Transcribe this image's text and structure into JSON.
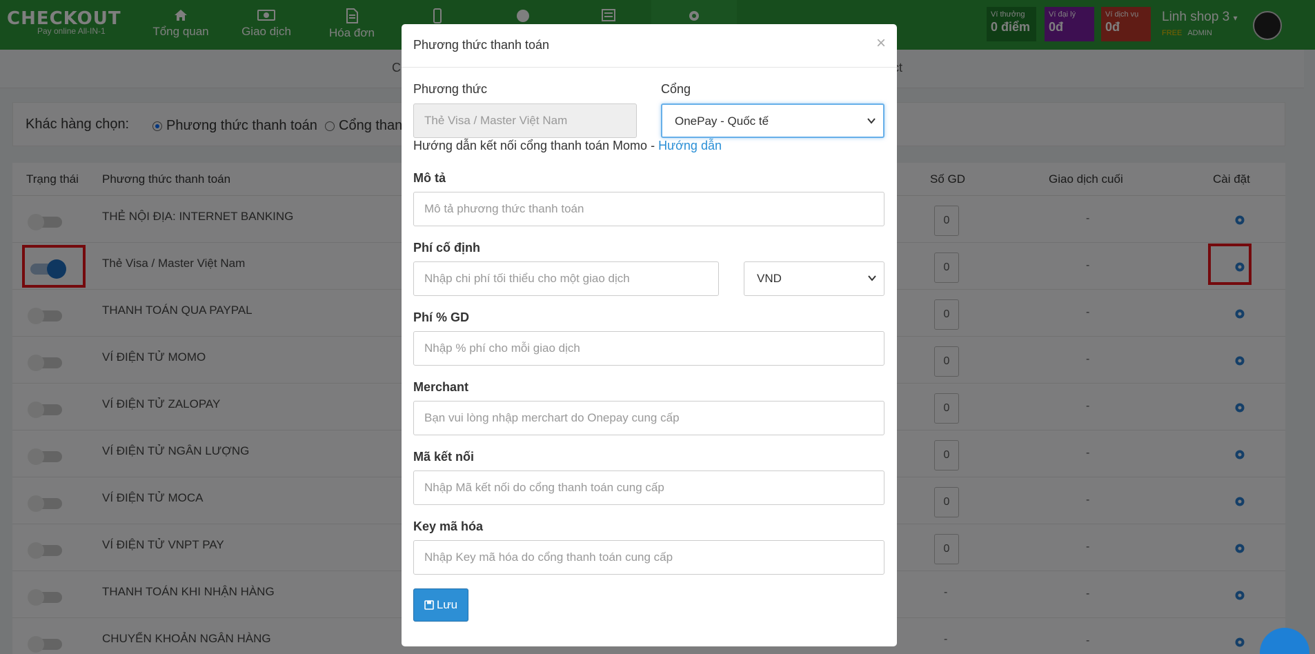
{
  "header": {
    "logo_main": "CHECKOUT",
    "logo_sub": "Pay online All-IN-1",
    "nav": [
      {
        "label": "Tổng quan",
        "icon": "home-icon"
      },
      {
        "label": "Giao dịch",
        "icon": "money-icon"
      },
      {
        "label": "Hóa đơn",
        "icon": "document-icon"
      },
      {
        "label": "",
        "icon": "mobile-icon"
      },
      {
        "label": "",
        "icon": "globe-icon"
      },
      {
        "label": "",
        "icon": "newspaper-icon"
      },
      {
        "label": "",
        "icon": "gear-icon"
      }
    ],
    "wallets": [
      {
        "label": "Ví thưởng",
        "value": "0 điểm",
        "color": "#1f7a2a"
      },
      {
        "label": "Ví đại lý",
        "value": "0đ",
        "color": "#7b1fa2"
      },
      {
        "label": "Ví dịch vụ",
        "value": "0đ",
        "color": "#c0392b"
      }
    ],
    "shop_name": "Linh shop 3",
    "plan": "FREE",
    "role": "ADMIN"
  },
  "subnav": {
    "left": "C",
    "right": "ct"
  },
  "filter": {
    "label": "Khác hàng chọn:",
    "option1": "Phương thức thanh toán",
    "option2": "Cổng than"
  },
  "table": {
    "headers": {
      "status": "Trạng thái",
      "method": "Phương thức thanh toán",
      "count": "Số GD",
      "last": "Giao dịch cuối",
      "settings": "Cài đặt"
    },
    "rows": [
      {
        "name": "THẺ NỘI ĐỊA: INTERNET BANKING",
        "on": false,
        "count": "0",
        "last": "-"
      },
      {
        "name": "Thẻ Visa / Master Việt Nam",
        "on": true,
        "count": "0",
        "last": "-"
      },
      {
        "name": "THANH TOÁN QUA PAYPAL",
        "on": false,
        "count": "0",
        "last": "-"
      },
      {
        "name": "VÍ ĐIỆN TỬ MOMO",
        "on": false,
        "count": "0",
        "last": "-"
      },
      {
        "name": "VÍ ĐIỆN TỬ ZALOPAY",
        "on": false,
        "count": "0",
        "last": "-"
      },
      {
        "name": "VÍ ĐIỆN TỬ NGÂN LƯỢNG",
        "on": false,
        "count": "0",
        "last": "-"
      },
      {
        "name": "VÍ ĐIỆN TỬ MOCA",
        "on": false,
        "count": "0",
        "last": "-"
      },
      {
        "name": "VÍ ĐIỆN TỬ VNPT PAY",
        "on": false,
        "count": "0",
        "last": "-"
      },
      {
        "name": "THANH TOÁN KHI NHẬN HÀNG",
        "on": false,
        "count": "-",
        "last": "-"
      },
      {
        "name": "CHUYỂN KHOẢN NGÂN HÀNG",
        "on": false,
        "count": "-",
        "last": "-"
      }
    ]
  },
  "modal": {
    "title": "Phương thức thanh toán",
    "close": "×",
    "method_label": "Phương thức",
    "method_value": "Thẻ Visa / Master Việt Nam",
    "gateway_label": "Cổng",
    "gateway_value": "OnePay - Quốc tế",
    "help_text": "Hướng dẫn kết nối cổng thanh toán Momo - ",
    "help_link": "Hướng dẫn",
    "desc_label": "Mô tả",
    "desc_placeholder": "Mô tả phương thức thanh toán",
    "fixed_fee_label": "Phí cố định",
    "fixed_fee_placeholder": "Nhập chi phí tối thiểu cho một giao dịch",
    "currency_value": "VND",
    "pct_fee_label": "Phí % GD",
    "pct_fee_placeholder": "Nhập % phí cho mỗi giao dịch",
    "merchant_label": "Merchant",
    "merchant_placeholder": "Bạn vui lòng nhập merchart do Onepay cung cấp",
    "code_label": "Mã kết nối",
    "code_placeholder": "Nhập Mã kết nối do cổng thanh toán cung cấp",
    "key_label": "Key mã hóa",
    "key_placeholder": "Nhập Key mã hóa do cổng thanh toán cung cấp",
    "save_label": "Lưu"
  }
}
